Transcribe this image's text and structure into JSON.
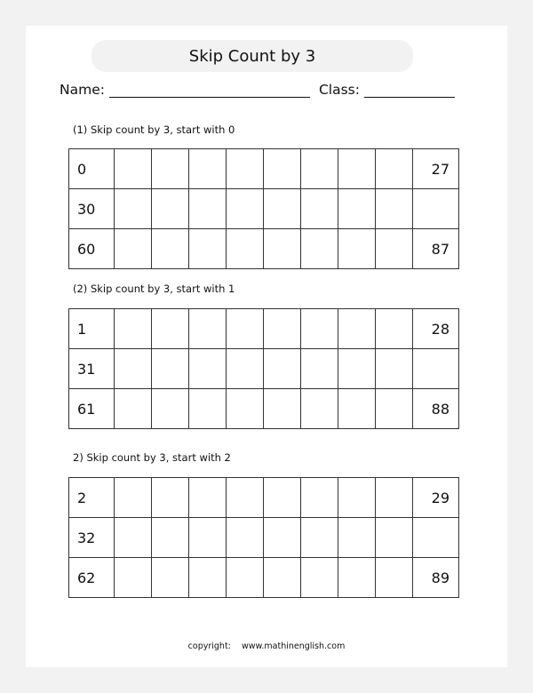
{
  "title": "Skip Count by 3",
  "header": {
    "name_label": "Name:",
    "class_label": "Class:"
  },
  "sections": [
    {
      "label": "(1) Skip count by 3, start with 0",
      "rows": [
        [
          "0",
          "",
          "",
          "",
          "",
          "",
          "",
          "",
          "",
          "27"
        ],
        [
          "30",
          "",
          "",
          "",
          "",
          "",
          "",
          "",
          "",
          ""
        ],
        [
          "60",
          "",
          "",
          "",
          "",
          "",
          "",
          "",
          "",
          "87"
        ]
      ]
    },
    {
      "label": "(2) Skip count by 3, start with 1",
      "rows": [
        [
          "1",
          "",
          "",
          "",
          "",
          "",
          "",
          "",
          "",
          "28"
        ],
        [
          "31",
          "",
          "",
          "",
          "",
          "",
          "",
          "",
          "",
          ""
        ],
        [
          "61",
          "",
          "",
          "",
          "",
          "",
          "",
          "",
          "",
          "88"
        ]
      ]
    },
    {
      "label": "2) Skip count by 3, start with 2",
      "rows": [
        [
          "2",
          "",
          "",
          "",
          "",
          "",
          "",
          "",
          "",
          "29"
        ],
        [
          "32",
          "",
          "",
          "",
          "",
          "",
          "",
          "",
          "",
          ""
        ],
        [
          "62",
          "",
          "",
          "",
          "",
          "",
          "",
          "",
          "",
          "89"
        ]
      ]
    }
  ],
  "footer": {
    "copyright": "copyright:    www.mathinenglish.com"
  },
  "colors": {
    "background": "#f2f2f2",
    "page": "#ffffff",
    "title_pill": "#f2f2f2",
    "grid_lines": "#333333",
    "text": "#111111"
  }
}
